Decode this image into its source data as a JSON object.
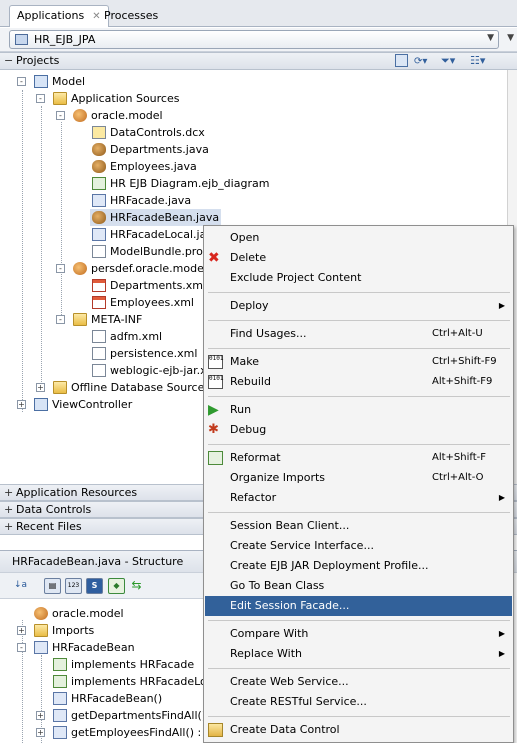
{
  "tabs": [
    {
      "label": "Applications",
      "close": "✕",
      "active": true
    },
    {
      "label": "Processes",
      "active": false
    }
  ],
  "app_selector": {
    "value": "HR_EJB_JPA"
  },
  "projects_panel": {
    "title": "Projects"
  },
  "tree": [
    {
      "label": "Model",
      "icon": "project-icon",
      "expand": "-"
    },
    {
      "label": "Application Sources",
      "icon": "folder-icon",
      "expand": "-"
    },
    {
      "label": "oracle.model",
      "icon": "package-icon",
      "expand": "-"
    },
    {
      "label": "DataControls.dcx",
      "icon": "file-icon"
    },
    {
      "label": "Departments.java",
      "icon": "bean-icon"
    },
    {
      "label": "Employees.java",
      "icon": "bean-icon"
    },
    {
      "label": "HR EJB Diagram.ejb_diagram",
      "icon": "diagram-icon"
    },
    {
      "label": "HRFacade.java",
      "icon": "interface-icon"
    },
    {
      "label": "HRFacadeBean.java",
      "icon": "session-bean-icon",
      "selected": true
    },
    {
      "label": "HRFacadeLocal.jav",
      "icon": "interface-icon"
    },
    {
      "label": "ModelBundle.prope",
      "icon": "file-icon"
    },
    {
      "label": "persdef.oracle.model",
      "icon": "package-icon",
      "expand": "-"
    },
    {
      "label": "Departments.xml",
      "icon": "xml-icon"
    },
    {
      "label": "Employees.xml",
      "icon": "xml-icon"
    },
    {
      "label": "META-INF",
      "icon": "folder-icon",
      "expand": "-"
    },
    {
      "label": "adfm.xml",
      "icon": "file-icon"
    },
    {
      "label": "persistence.xml",
      "icon": "file-icon"
    },
    {
      "label": "weblogic-ejb-jar.xn",
      "icon": "file-icon"
    },
    {
      "label": "Offline Database Sources",
      "icon": "folder-icon",
      "expand": "+"
    },
    {
      "label": "ViewController",
      "icon": "project-icon",
      "expand": "+"
    }
  ],
  "accordions": [
    {
      "label": "Application Resources",
      "pm": "+"
    },
    {
      "label": "Data Controls",
      "pm": "+"
    },
    {
      "label": "Recent Files",
      "pm": "+"
    }
  ],
  "structure": {
    "title": "HRFacadeBean.java - Structure",
    "toolbar": {
      "sort": "↓a",
      "b1": "▤",
      "b2": "123",
      "b3": "S"
    },
    "items": [
      {
        "label": "oracle.model",
        "icon": "package-icon"
      },
      {
        "label": "Imports",
        "icon": "folder-icon",
        "expand": "+"
      },
      {
        "label": "HRFacadeBean",
        "icon": "class-icon",
        "expand": "-"
      },
      {
        "label": "implements HRFacade",
        "icon": "interface-icon"
      },
      {
        "label": "implements HRFacadeLocal",
        "icon": "interface-icon"
      },
      {
        "label": "HRFacadeBean()",
        "icon": "constructor-icon"
      },
      {
        "label": "getDepartmentsFindAll()",
        "icon": "method-icon",
        "expand": "+"
      },
      {
        "label": "getEmployeesFindAll() :",
        "icon": "method-icon",
        "expand": "+"
      }
    ]
  },
  "context_menu": {
    "items": [
      {
        "label": "Open"
      },
      {
        "label": "Delete",
        "icon": "delete-icon"
      },
      {
        "label": "Exclude Project Content"
      },
      {
        "sep": true
      },
      {
        "label": "Deploy",
        "submenu": "▶"
      },
      {
        "sep": true
      },
      {
        "label": "Find Usages...",
        "shortcut": "Ctrl+Alt-U"
      },
      {
        "sep": true
      },
      {
        "label": "Make",
        "shortcut": "Ctrl+Shift-F9",
        "icon": "make-icon"
      },
      {
        "label": "Rebuild",
        "shortcut": "Alt+Shift-F9",
        "icon": "rebuild-icon"
      },
      {
        "sep": true
      },
      {
        "label": "Run",
        "icon": "run-icon"
      },
      {
        "label": "Debug",
        "icon": "debug-icon"
      },
      {
        "sep": true
      },
      {
        "label": "Reformat",
        "shortcut": "Alt+Shift-F",
        "icon": "reformat-icon"
      },
      {
        "label": "Organize Imports",
        "shortcut": "Ctrl+Alt-O"
      },
      {
        "label": "Refactor",
        "submenu": "▶"
      },
      {
        "sep": true
      },
      {
        "label": "Session Bean Client..."
      },
      {
        "label": "Create Service Interface..."
      },
      {
        "label": "Create EJB JAR Deployment Profile..."
      },
      {
        "label": "Go To Bean Class"
      },
      {
        "label": "Edit Session Facade...",
        "selected": true
      },
      {
        "sep": true
      },
      {
        "label": "Compare With",
        "submenu": "▶"
      },
      {
        "label": "Replace With",
        "submenu": "▶"
      },
      {
        "sep": true
      },
      {
        "label": "Create Web Service..."
      },
      {
        "label": "Create RESTful Service..."
      },
      {
        "sep": true
      },
      {
        "label": "Create Data Control",
        "icon": "data-control-icon"
      }
    ]
  }
}
